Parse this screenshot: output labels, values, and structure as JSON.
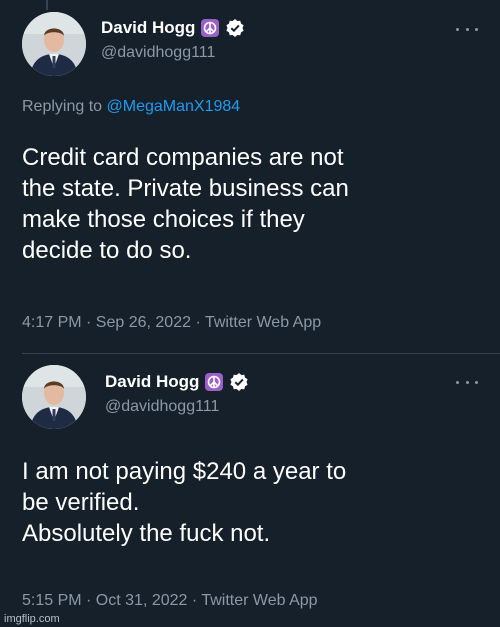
{
  "tweets": [
    {
      "author": {
        "display_name": "David Hogg",
        "handle": "@davidhogg111"
      },
      "reply": {
        "prefix": "Replying to",
        "mention": "@MegaManX1984"
      },
      "text_lines": [
        "Credit card companies are not",
        "the state. Private business can",
        "make those choices if they",
        "decide to do so."
      ],
      "timestamp": "4:17 PM · Sep 26, 2022 · Twitter Web App"
    },
    {
      "author": {
        "display_name": "David Hogg",
        "handle": "@davidhogg111"
      },
      "text_lines": [
        "I am not paying $240 a year to",
        "be verified.",
        "Absolutely the fuck not."
      ],
      "timestamp": "5:15 PM · Oct 31, 2022 · Twitter Web App"
    }
  ],
  "watermark": "imgflip.com",
  "icons": {
    "peace_badge": "peace-symbol-icon",
    "verified_badge": "verified-check-icon",
    "more": "more-dots-icon"
  },
  "colors": {
    "background": "#15202b",
    "text": "#ffffff",
    "secondary_text": "#8b98a5",
    "link": "#1d9bf0",
    "peace_badge": "#9a5fc8"
  }
}
